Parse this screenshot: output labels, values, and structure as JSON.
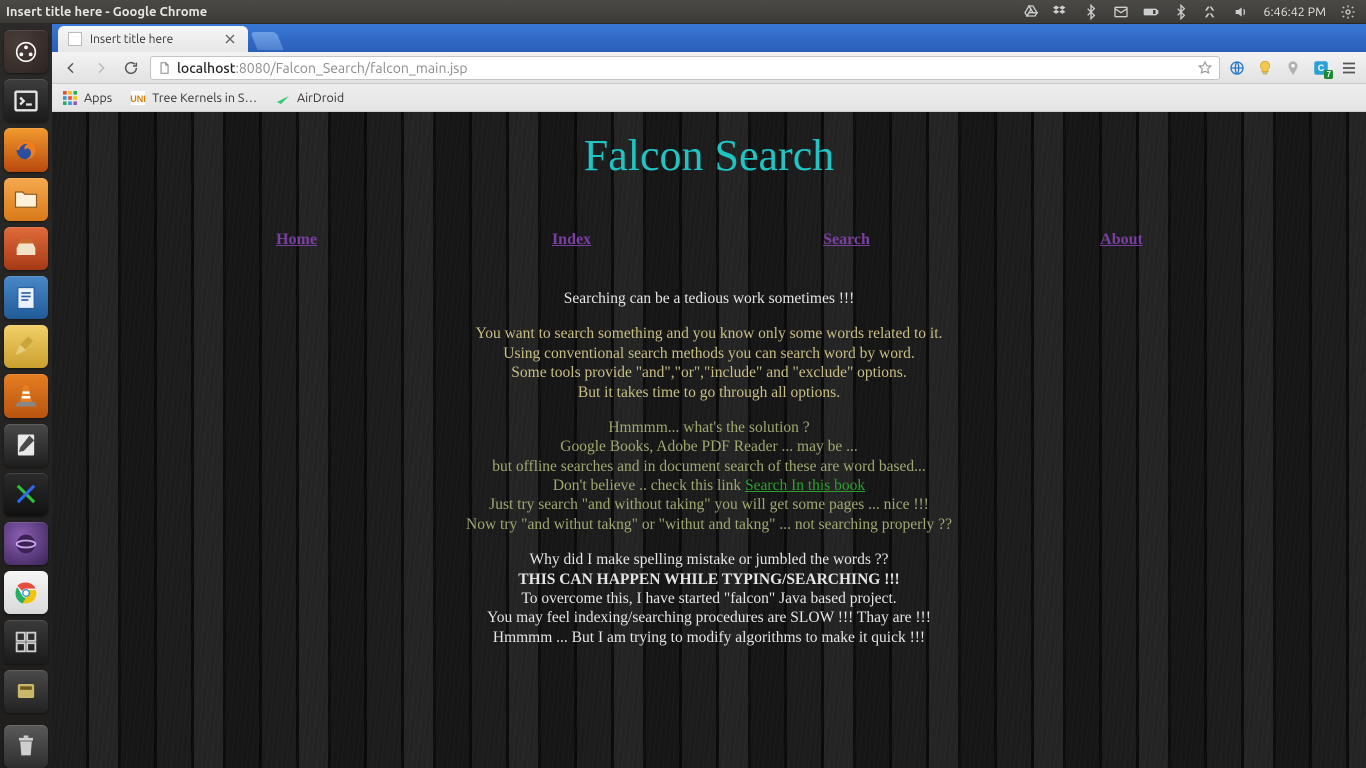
{
  "system": {
    "window_title": "Insert title here - Google Chrome",
    "clock": "6:46:42 PM"
  },
  "launcher": {
    "items": [
      "dash",
      "terminal",
      "firefox",
      "files",
      "software-center",
      "libreoffice-writer",
      "sweep",
      "vlc",
      "gedit",
      "x-app",
      "eclipse",
      "chrome",
      "workspace-switcher",
      "external-drive"
    ]
  },
  "chrome": {
    "tab_title": "Insert title here",
    "url_display": "localhost:8080/Falcon_Search/falcon_main.jsp",
    "url_host": "localhost",
    "url_rest": ":8080/Falcon_Search/falcon_main.jsp",
    "bookmarks": {
      "apps": "Apps",
      "b1": "Tree Kernels in S…",
      "b2": "AirDroid"
    },
    "ext_badge": "7"
  },
  "page": {
    "title": "Falcon Search",
    "nav": {
      "home": "Home",
      "index": "Index",
      "search": "Search",
      "about": "About"
    },
    "p0": "Searching can be a tedious work sometimes !!!",
    "p1": "You want to search something and you know only some words related to it.",
    "p2": "Using conventional search methods you can search word by word.",
    "p3": "Some tools provide \"and\",\"or\",\"include\" and \"exclude\" options.",
    "p4": "But it takes time to go through all options.",
    "p5": "Hmmmm... what's the solution ?",
    "p6": "Google Books, Adobe PDF Reader ... may be ...",
    "p7": "but offline searches and in document search of these are word based...",
    "p8a": "Don't believe .. check this link ",
    "p8link": "Search In this book",
    "p9": "Just try search \"and without taking\" you will get some pages ... nice !!!",
    "p10": "Now try \"and withut takng\" or \"withut and takng\" ... not searching properly ??",
    "p11": "Why did I make spelling mistake or jumbled the words ??",
    "p12": "THIS CAN HAPPEN WHILE TYPING/SEARCHING !!!",
    "p13": "To overcome this, I have started \"falcon\" Java based project.",
    "p14": "You may feel indexing/searching procedures are SLOW !!! Thay are !!!",
    "p15": "Hmmmm ... But I am trying to modify algorithms to make it quick !!!"
  }
}
